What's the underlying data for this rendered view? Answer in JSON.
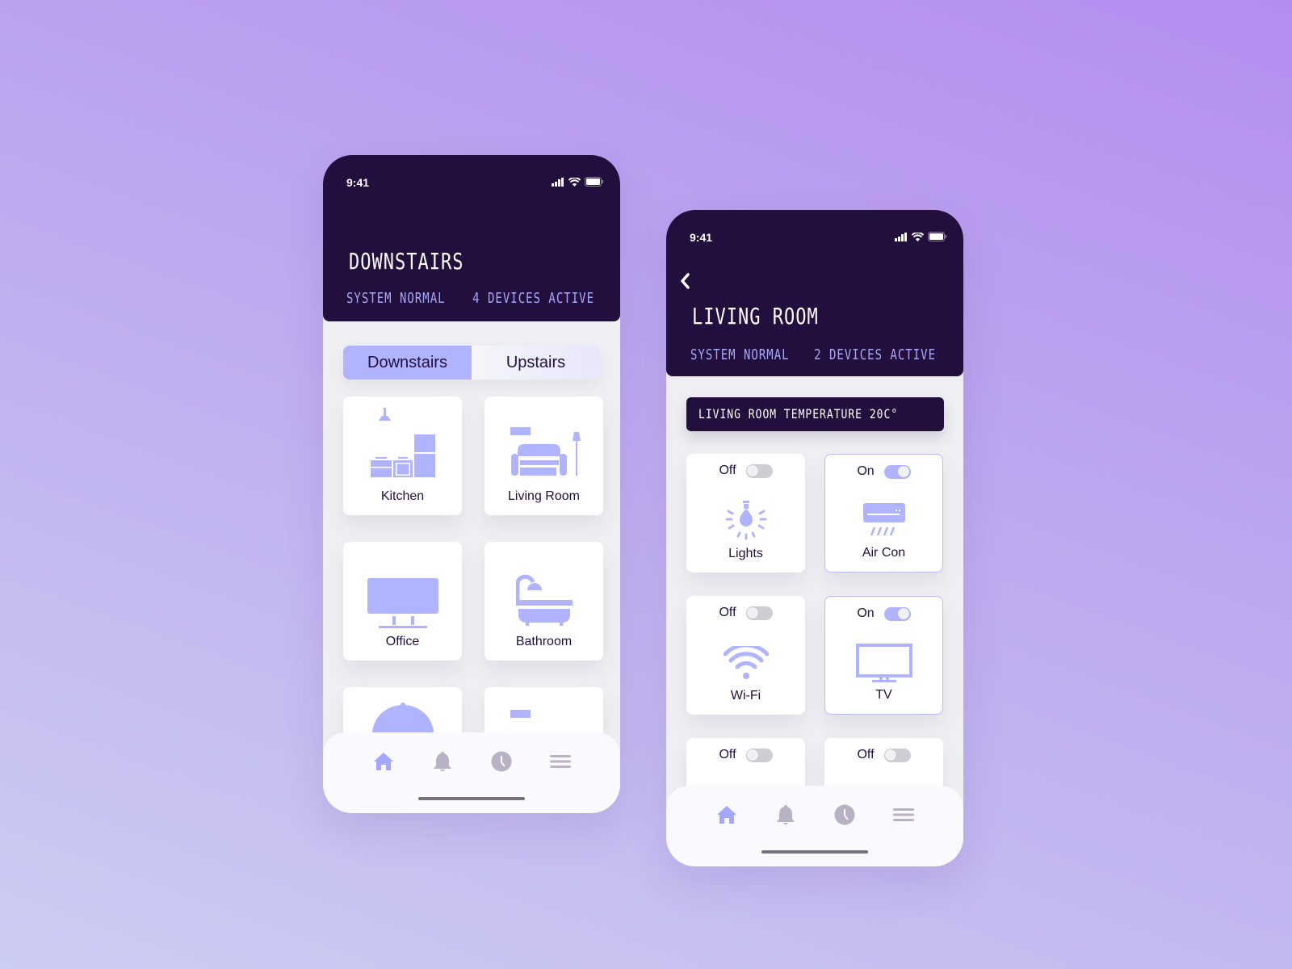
{
  "colors": {
    "header_bg": "#220f3d",
    "accent": "#b0b3fd",
    "muted_icon": "#b9b2c4",
    "text_dark": "#220f3d",
    "lcd_meta": "#a9a8f6"
  },
  "phone1": {
    "status": {
      "time": "9:41",
      "icons": [
        "signal-icon",
        "wifi-icon",
        "battery-icon"
      ]
    },
    "header": {
      "title": "Downstairs",
      "system_status": "System Normal",
      "devices_active": "4 Devices Active"
    },
    "segments": {
      "active": "Downstairs",
      "inactive": "Upstairs"
    },
    "rooms": [
      {
        "label": "Kitchen",
        "icon": "kitchen-icon"
      },
      {
        "label": "Living Room",
        "icon": "sofa-icon"
      },
      {
        "label": "Office",
        "icon": "monitor-icon"
      },
      {
        "label": "Bathroom",
        "icon": "bathtub-icon"
      },
      {
        "label": "",
        "icon": "dining-cloche-icon"
      },
      {
        "label": "",
        "icon": "bedroom-icon"
      }
    ],
    "nav": [
      {
        "name": "home",
        "active": true
      },
      {
        "name": "notifications",
        "active": false
      },
      {
        "name": "history",
        "active": false
      },
      {
        "name": "menu",
        "active": false
      }
    ]
  },
  "phone2": {
    "status": {
      "time": "9:41",
      "icons": [
        "signal-icon",
        "wifi-icon",
        "battery-icon"
      ]
    },
    "header": {
      "title": "Living Room",
      "system_status": "System Normal",
      "devices_active": "2 Devices Active"
    },
    "temperature": "Living Room Temperature 20C°",
    "devices": [
      {
        "label": "Lights",
        "state": "Off",
        "on": false,
        "icon": "light-bulb-icon"
      },
      {
        "label": "Air Con",
        "state": "On",
        "on": true,
        "icon": "air-conditioner-icon"
      },
      {
        "label": "Wi-Fi",
        "state": "Off",
        "on": false,
        "icon": "wifi-icon"
      },
      {
        "label": "TV",
        "state": "On",
        "on": true,
        "icon": "tv-icon"
      },
      {
        "label": "",
        "state": "Off",
        "on": false,
        "icon": ""
      },
      {
        "label": "",
        "state": "Off",
        "on": false,
        "icon": ""
      }
    ],
    "nav": [
      {
        "name": "home",
        "active": true
      },
      {
        "name": "notifications",
        "active": false
      },
      {
        "name": "history",
        "active": false
      },
      {
        "name": "menu",
        "active": false
      }
    ]
  }
}
